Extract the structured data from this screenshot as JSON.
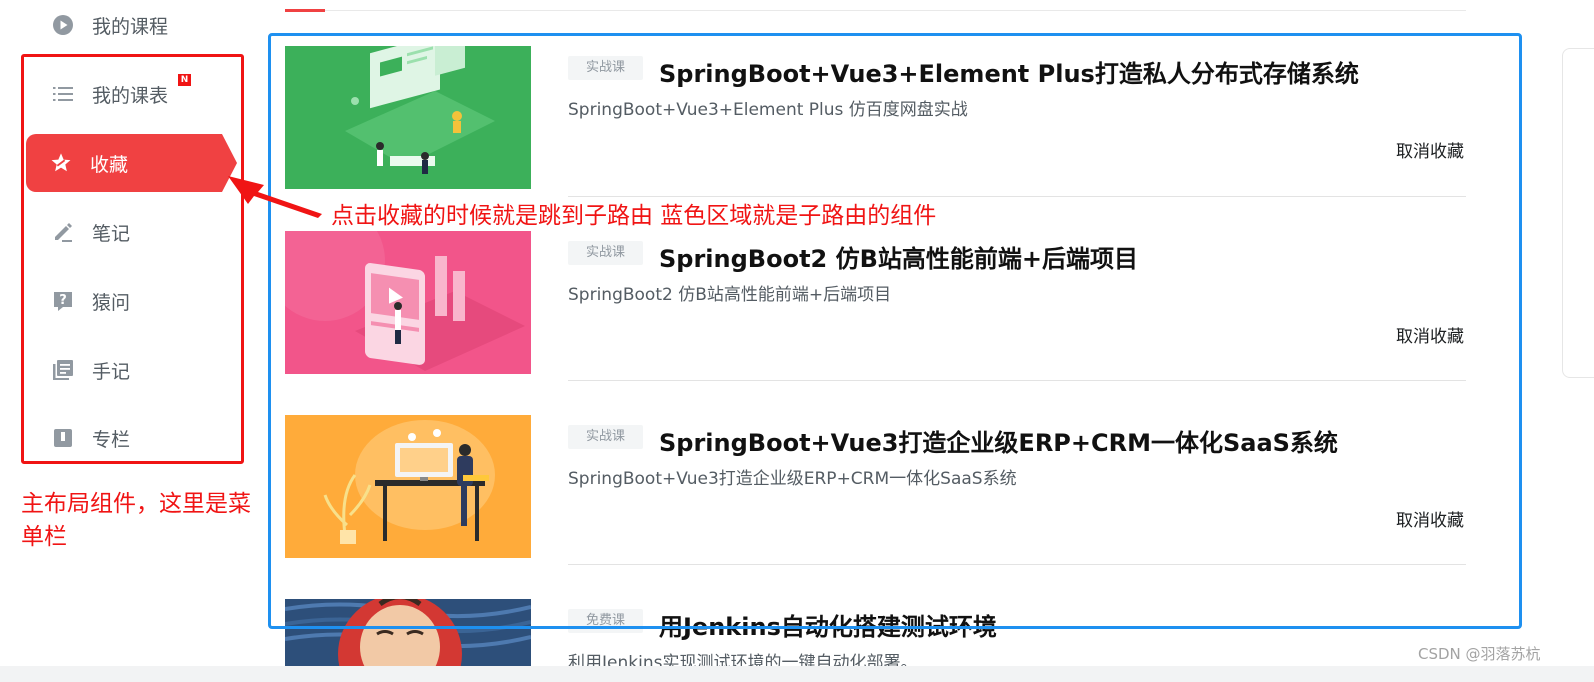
{
  "sidebar": {
    "items": [
      {
        "label": "我的课程",
        "icon": "play-circle-icon"
      },
      {
        "label": "我的课表",
        "icon": "list-icon",
        "badge": "N"
      },
      {
        "label": "收藏",
        "icon": "star-icon"
      },
      {
        "label": "笔记",
        "icon": "pencil-icon"
      },
      {
        "label": "猿问",
        "icon": "question-icon"
      },
      {
        "label": "手记",
        "icon": "book-icon"
      },
      {
        "label": "专栏",
        "icon": "column-icon"
      }
    ],
    "active_index": 2
  },
  "annotations": {
    "menu_note": "主布局组件，这里是菜单栏",
    "route_note": "点击收藏的时候就是跳到子路由  蓝色区域就是子路由的组件"
  },
  "colors": {
    "accent": "#f04142",
    "annotation_red": "#f01414",
    "annotation_blue": "#1e90f0"
  },
  "courses": [
    {
      "badge": "实战课",
      "title": "SpringBoot+Vue3+Element Plus打造私人分布式存储系统",
      "desc": "SpringBoot+Vue3+Element Plus 仿百度网盘实战",
      "action": "取消收藏",
      "thumb_color": "#3cb05a"
    },
    {
      "badge": "实战课",
      "title": "SpringBoot2 仿B站高性能前端+后端项目",
      "desc": "SpringBoot2 仿B站高性能前端+后端项目",
      "action": "取消收藏",
      "thumb_color": "#f2558a"
    },
    {
      "badge": "实战课",
      "title": "SpringBoot+Vue3打造企业级ERP+CRM一体化SaaS系统",
      "desc": "SpringBoot+Vue3打造企业级ERP+CRM一体化SaaS系统",
      "action": "取消收藏",
      "thumb_color": "#ffab3a"
    },
    {
      "badge": "免费课",
      "title": "用Jenkins自动化搭建测试环境",
      "desc": "利用Jenkins实现测试环境的一键自动化部署。",
      "action": "",
      "thumb_color": "#2d4f7a"
    }
  ],
  "watermark": "CSDN @羽落苏杭"
}
